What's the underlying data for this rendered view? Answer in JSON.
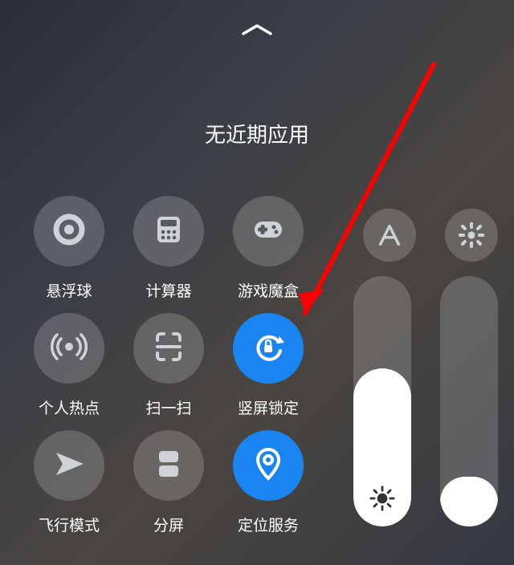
{
  "title": "无近期应用",
  "tiles": [
    {
      "label": "悬浮球",
      "icon": "floating-ball",
      "active": false
    },
    {
      "label": "计算器",
      "icon": "calculator",
      "active": false
    },
    {
      "label": "游戏魔盒",
      "icon": "game-box",
      "active": false
    },
    {
      "label": "个人热点",
      "icon": "hotspot",
      "active": false
    },
    {
      "label": "扫一扫",
      "icon": "scan",
      "active": false
    },
    {
      "label": "竖屏锁定",
      "icon": "rotation-lock",
      "active": true
    },
    {
      "label": "飞行模式",
      "icon": "airplane",
      "active": false
    },
    {
      "label": "分屏",
      "icon": "split-screen",
      "active": false
    },
    {
      "label": "定位服务",
      "icon": "location",
      "active": true
    }
  ],
  "top_buttons": [
    {
      "icon": "font",
      "name": "font-button"
    },
    {
      "icon": "settings",
      "name": "settings-button"
    }
  ],
  "sliders": {
    "brightness": {
      "value_pct": 63,
      "icon": "brightness"
    },
    "volume": {
      "value_pct": 20,
      "icon": "volume"
    }
  }
}
